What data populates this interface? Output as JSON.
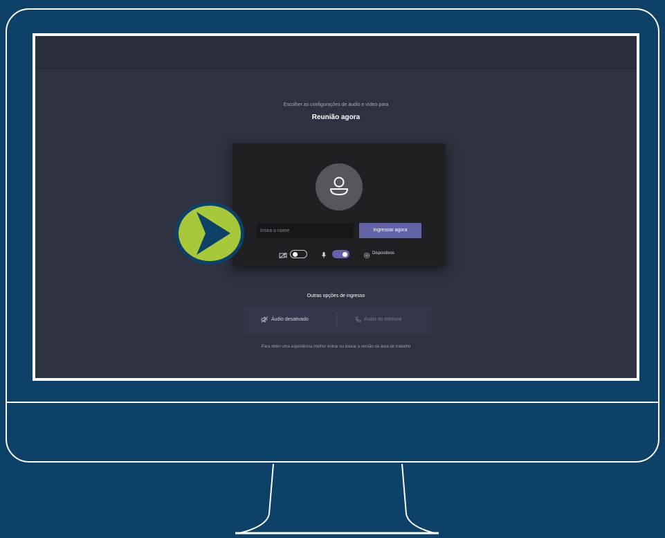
{
  "screen": {
    "subtitle": "Escolher as configurações de áudio e vídeo para",
    "meeting_title": "Reunião agora"
  },
  "card": {
    "name_placeholder": "Insira o nome",
    "join_label": "Ingressar agora",
    "camera_toggle_on": false,
    "mic_toggle_on": true,
    "devices_label": "Dispositivos"
  },
  "other_options": {
    "title": "Outras opções de ingresso",
    "audio_off_label": "Áudio desativado",
    "phone_audio_label": "Áudio do telefone"
  },
  "footer_note": "Para obter uma experiência melhor entrar ou baixar a versão da área de trabalho",
  "colors": {
    "background": "#0e4168",
    "screen": "#2e3140",
    "accent": "#6264a7",
    "marker_green": "#a6c83a"
  },
  "icons": [
    "user-avatar-icon",
    "camera-off-icon",
    "microphone-icon",
    "gear-icon",
    "speaker-off-icon",
    "phone-icon",
    "play-arrow-icon"
  ]
}
